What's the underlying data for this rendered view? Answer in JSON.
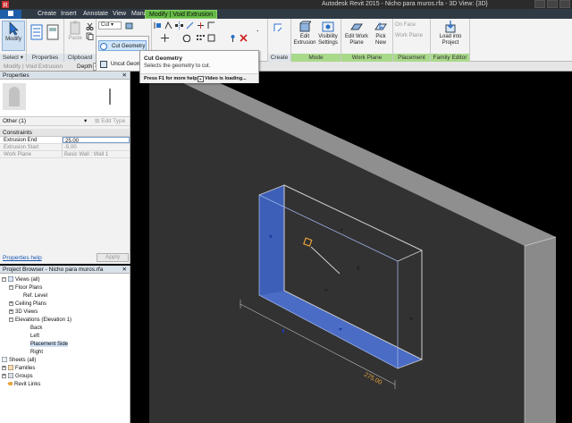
{
  "app": {
    "title": "Autodesk Revit 2015 -   Nicho para muros.rfa - 3D View: {3D}"
  },
  "ribbon": {
    "tabs": [
      "Create",
      "Insert",
      "Annotate",
      "View",
      "Manage"
    ],
    "context_tab": "Modify | Void Extrusion",
    "panels": {
      "select": "Select",
      "properties": "Properties",
      "clipboard": "Clipboard",
      "create": "Create",
      "mode": "Mode",
      "work_plane": "Work Plane",
      "placement": "Placement",
      "family_editor": "Family Editor"
    },
    "buttons": {
      "modify": "Modify",
      "paste": "Paste",
      "cut": "Cut",
      "cut_geometry": "Cut Geometry",
      "uncut_geometry": "Uncut Geom",
      "edit_extrusion": "Edit Extrusion",
      "visibility_settings": "Visibility Settings",
      "edit_work_plane": "Edit Work Plane",
      "pick_new": "Pick New",
      "on_face": "On Face",
      "on_work_plane": "Work Plane",
      "load_into_project": "Load into Project"
    }
  },
  "tooltip": {
    "title": "Cut Geometry",
    "description": "Selects the geometry to cut.",
    "help": "Press F1 for more help",
    "video": "Video is loading..."
  },
  "options_bar": {
    "context": "Modify | Void Extrusion",
    "depth_label": "Depth",
    "depth_value": "3"
  },
  "properties": {
    "title": "Properties",
    "filter": "Other (1)",
    "edit_type": "Edit Type",
    "group": "Constraints",
    "rows": [
      {
        "name": "Extrusion End",
        "value": "25.00"
      },
      {
        "name": "Extrusion Start",
        "value": "-5.00"
      },
      {
        "name": "Work Plane",
        "value": "Basic Wall : Wall 1"
      }
    ],
    "help_link": "Properties help",
    "apply": "Apply"
  },
  "project_browser": {
    "title": "Project Browser - Nicho para muros.rfa",
    "items": [
      {
        "label": "Views (all)"
      },
      {
        "label": "Floor Plans"
      },
      {
        "label": "Ref. Level"
      },
      {
        "label": "Ceiling Plans"
      },
      {
        "label": "3D Views"
      },
      {
        "label": "Elevations (Elevation 1)"
      },
      {
        "label": "Back"
      },
      {
        "label": "Left"
      },
      {
        "label": "Placement Side"
      },
      {
        "label": "Right"
      },
      {
        "label": "Sheets (all)"
      },
      {
        "label": "Families"
      },
      {
        "label": "Groups"
      },
      {
        "label": "Revit Links"
      }
    ]
  },
  "viewport": {
    "dimension_text": "275.00"
  },
  "colors": {
    "context_tab": "#64b945",
    "void_blue": "#3d5fb8",
    "dimension_orange": "#e8a33a"
  }
}
